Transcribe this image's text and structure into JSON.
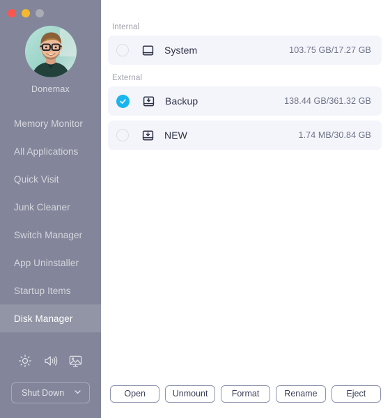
{
  "window": {
    "traffic_lights": [
      {
        "name": "close",
        "color": "#f9564f"
      },
      {
        "name": "minimize",
        "color": "#f5b82e"
      },
      {
        "name": "zoom",
        "color": "#a9abb5"
      }
    ]
  },
  "sidebar": {
    "profile": {
      "name": "Donemax",
      "avatar_icon": "user-avatar-photo"
    },
    "items": [
      {
        "label": "Memory Monitor",
        "active": false
      },
      {
        "label": "All Applications",
        "active": false
      },
      {
        "label": "Quick Visit",
        "active": false
      },
      {
        "label": "Junk Cleaner",
        "active": false
      },
      {
        "label": "Switch Manager",
        "active": false
      },
      {
        "label": "App Uninstaller",
        "active": false
      },
      {
        "label": "Startup Items",
        "active": false
      },
      {
        "label": "Disk Manager",
        "active": true
      }
    ],
    "system_icons": [
      {
        "name": "brightness-icon"
      },
      {
        "name": "volume-icon"
      },
      {
        "name": "display-icon"
      }
    ],
    "power": {
      "label": "Shut Down",
      "chevron_icon": "chevron-down-icon"
    },
    "colors": {
      "background": "#83869a",
      "active_item": "#9295a6",
      "text": "#d5d6dd"
    }
  },
  "main": {
    "groups": [
      {
        "label": "Internal",
        "disks": [
          {
            "name": "System",
            "capacity": "103.75 GB/17.27 GB",
            "selected": false,
            "icon": "internal-disk-icon"
          }
        ]
      },
      {
        "label": "External",
        "disks": [
          {
            "name": "Backup",
            "capacity": "138.44 GB/361.32 GB",
            "selected": true,
            "icon": "external-disk-icon"
          },
          {
            "name": "NEW",
            "capacity": "1.74 MB/30.84 GB",
            "selected": false,
            "icon": "external-disk-icon"
          }
        ]
      }
    ],
    "actions": [
      {
        "label": "Open"
      },
      {
        "label": "Unmount"
      },
      {
        "label": "Format"
      },
      {
        "label": "Rename"
      },
      {
        "label": "Eject"
      }
    ],
    "colors": {
      "row_background": "#f4f5fb",
      "selected_accent": "#18b5ef",
      "button_border": "#8e93ae"
    }
  }
}
